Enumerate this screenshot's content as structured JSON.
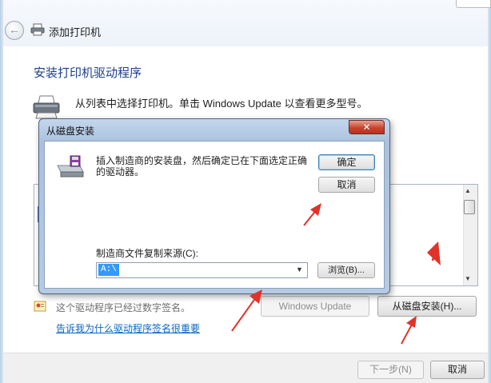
{
  "wizard": {
    "title": "添加打印机",
    "heading": "安装打印机驱动程序",
    "instruction": "从列表中选择打印机。单击 Windows Update 以查看更多型号。",
    "verified_text": "这个驱动程序已经过数字签名。",
    "why_link": "告诉我为什么驱动程序签名很重要",
    "windows_update_label": "Windows Update",
    "have_disk_label": "从磁盘安装(H)...",
    "next_label": "下一步(N)",
    "cancel_label": "取消"
  },
  "dialog": {
    "title": "从磁盘安装",
    "close_symbol": "✕",
    "message": "插入制造商的安装盘，然后确定已在下面选定正确的驱动器。",
    "ok_label": "确定",
    "cancel_label": "取消",
    "source_label": "制造商文件复制来源(C):",
    "source_value": "A:\\",
    "browse_label": "浏览(B)..."
  },
  "colors": {
    "heading": "#1e3f8a",
    "link": "#0a66c2",
    "selection": "#3399ff",
    "close_button": "#c8442d",
    "annotation_arrow": "#e0332a"
  },
  "icons": [
    "back-arrow-icon",
    "printer-icon",
    "disk-drive-icon",
    "shield-icon",
    "close-icon",
    "chevron-down-icon"
  ]
}
